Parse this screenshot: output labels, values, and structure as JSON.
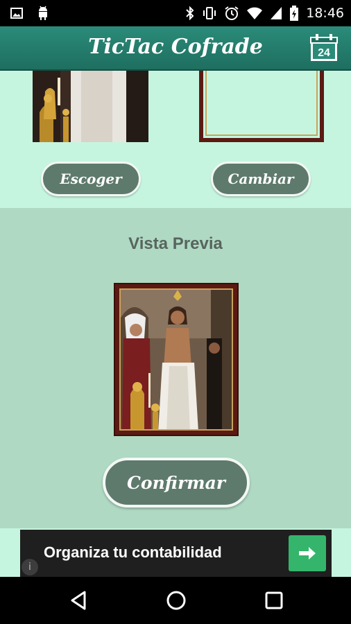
{
  "status_bar": {
    "time": "18:46",
    "icons": [
      "image-icon",
      "android-icon",
      "bluetooth-icon",
      "vibrate-icon",
      "alarm-icon",
      "wifi-icon",
      "signal-icon",
      "battery-icon"
    ]
  },
  "app_bar": {
    "title": "TicTac Cofrade",
    "calendar_day": "24"
  },
  "selection": {
    "choose_label": "Escoger",
    "change_label": "Cambiar"
  },
  "preview": {
    "title": "Vista Previa",
    "confirm_label": "Confirmar"
  },
  "ad": {
    "text": "Organiza tu contabilidad",
    "info_symbol": "i"
  },
  "colors": {
    "action_bar": "#2b8b79",
    "content_bg": "#c6f5df",
    "preview_bg": "#afd9c2",
    "button": "#5e7a6c",
    "frame": "#5b1a12",
    "frame_gold": "#c9a25a",
    "ad_accent": "#34b56b"
  }
}
